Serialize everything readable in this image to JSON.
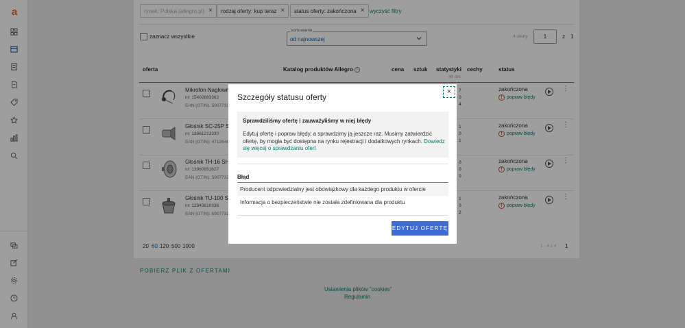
{
  "brand": {
    "logo": "a",
    "accent": "#ff5a00",
    "link_color": "#0c7a6e",
    "primary": "#3d6bd8"
  },
  "filters": {
    "chips": [
      {
        "label": "rynek: Polska (allegro.pl)",
        "enabled": false
      },
      {
        "label": "rodzaj oferty: kup teraz",
        "enabled": true
      },
      {
        "label": "status oferty: zakończona",
        "enabled": true
      }
    ],
    "clear": "wyczyść filtry"
  },
  "toolbar": {
    "select_all": "zaznacz wszystkie",
    "sort_label": "sortowanie",
    "sort_value": "od najnowszej",
    "offers_count": "4 oferty",
    "page": "1",
    "page_of": "z",
    "page_total": "1"
  },
  "table": {
    "headers": {
      "offer": "oferta",
      "catalog": "Katalog produktów Allegro",
      "price": "cena",
      "qty": "sztuk",
      "stats": "statystyki",
      "stats_sub": "30 dni",
      "features": "cechy",
      "status": "status"
    },
    "rows": [
      {
        "name": "Mikrofon Nagłowny",
        "nr": "nr: 15402883362",
        "ean": "EAN (GTIN): 5907732",
        "stats": [
          "7",
          "0",
          "4"
        ],
        "status": "zakończona",
        "action": "popraw błędy"
      },
      {
        "name": "Głośnik SC-25P Sh",
        "nr": "nr: 13961213330",
        "ean": "EAN (GTIN): 4712646",
        "stats": [
          "1",
          "0",
          "1"
        ],
        "status": "zakończona",
        "action": "popraw błędy"
      },
      {
        "name": "Głośnik TH-16 SHO",
        "nr": "nr: 13960951627",
        "ean": "EAN (GTIN): 5907732",
        "stats": [
          "0",
          "0",
          "0"
        ],
        "status": "zakończona",
        "action": "popraw błędy"
      },
      {
        "name": "Głośnik TU-100 SH",
        "nr": "nr: 12843610336",
        "ean": "EAN (GTIN): 5907732",
        "stats": [
          "1",
          "0",
          "2"
        ],
        "status": "zakończona",
        "action": "popraw błędy"
      }
    ]
  },
  "pagination": {
    "per_page": [
      "20",
      "60",
      "120",
      "500",
      "1000"
    ],
    "per_page_active": "60",
    "range": "1 - 4 z 4",
    "current": "1"
  },
  "download": "POBIERZ PLIK Z OFERTAMI",
  "footer": {
    "cookies": "Ustawienia plików \"cookies\"",
    "rules": "Regulamin"
  },
  "modal": {
    "title": "Szczegóły statusu oferty",
    "box_heading": "Sprawdziliśmy ofertę i zauważyliśmy w niej błędy",
    "box_body": "Edytuj ofertę i popraw błędy, a sprawdzimy ją jeszcze raz. Musimy zatwierdzić ofertę, by mogła być dostępna na rynku rejestracji i dodatkowych rynkach.",
    "box_link": "Dowiedz się więcej o sprawdzaniu ofert",
    "error_header": "Błąd",
    "errors": [
      "Producent odpowiedzialny jest obowiązkowy dla każdego produktu w ofercie",
      "Informacja o bezpieczeństwie nie została zdefiniowana dla produktu"
    ],
    "edit_button": "EDYTUJ OFERTĘ",
    "close": "×"
  }
}
